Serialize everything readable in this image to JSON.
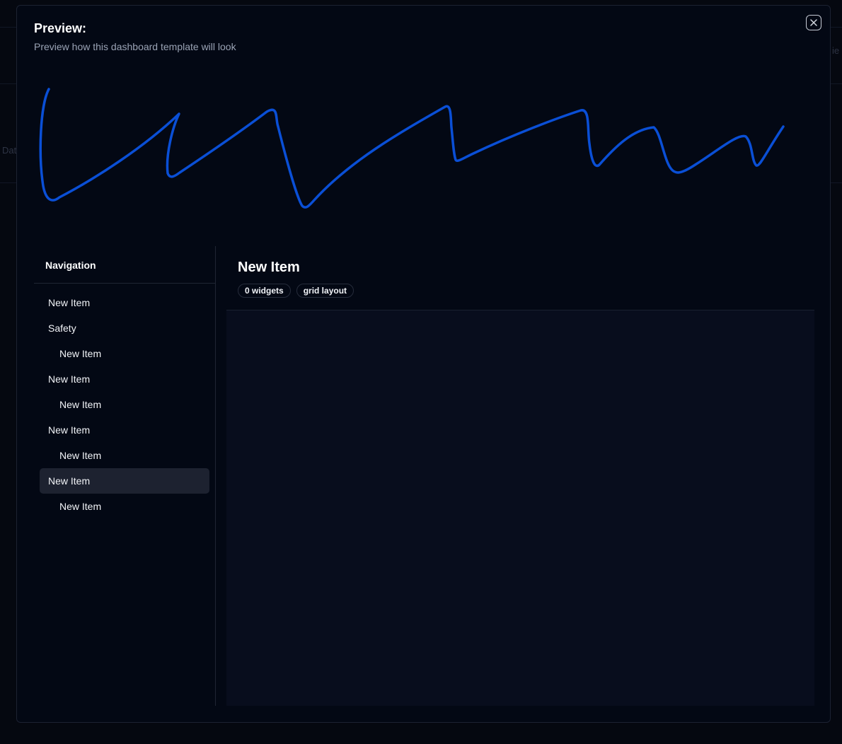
{
  "background": {
    "left_fragment": "Dat",
    "right_fragment": "ie"
  },
  "modal": {
    "title": "Preview:",
    "subtitle": "Preview how this dashboard template will look",
    "close_icon": "close-x-icon",
    "scribble_color": "#0a4fd6"
  },
  "sidebar": {
    "title": "Navigation",
    "items": [
      {
        "label": "New Item",
        "level": 0,
        "active": false
      },
      {
        "label": "Safety",
        "level": 0,
        "active": false
      },
      {
        "label": "New Item",
        "level": 1,
        "active": false
      },
      {
        "label": "New Item",
        "level": 0,
        "active": false
      },
      {
        "label": "New Item",
        "level": 1,
        "active": false
      },
      {
        "label": "New Item",
        "level": 0,
        "active": false
      },
      {
        "label": "New Item",
        "level": 1,
        "active": false
      },
      {
        "label": "New Item",
        "level": 0,
        "active": true
      },
      {
        "label": "New Item",
        "level": 1,
        "active": false
      }
    ]
  },
  "content": {
    "title": "New Item",
    "badges": [
      "0 widgets",
      "grid layout"
    ]
  }
}
